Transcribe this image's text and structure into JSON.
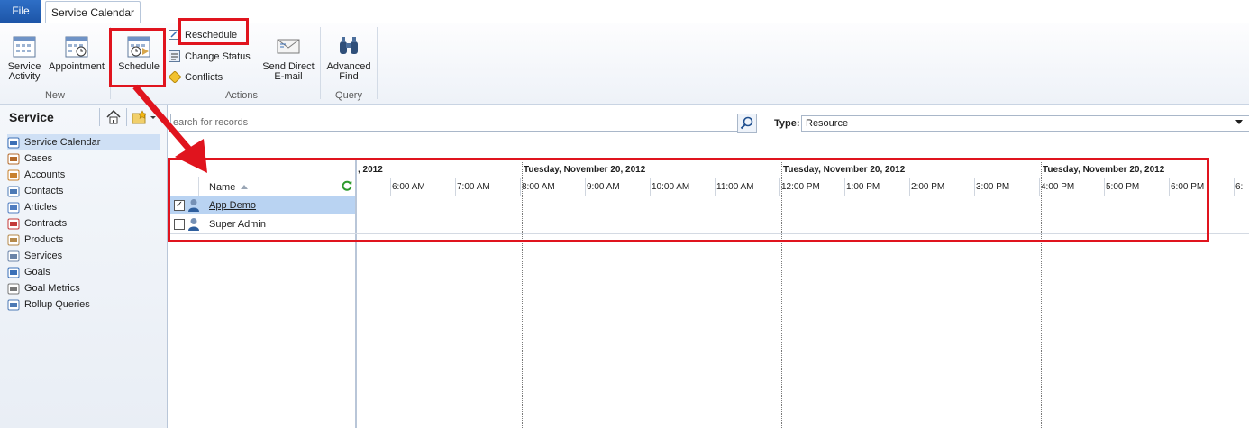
{
  "tabs": {
    "file": "File",
    "active": "Service Calendar"
  },
  "ribbon": {
    "new_group": {
      "label": "New",
      "service_activity": [
        "Service",
        "Activity"
      ],
      "appointment": "Appointment",
      "schedule": "Schedule"
    },
    "actions_group": {
      "label": "Actions",
      "reschedule": "Reschedule",
      "change_status": "Change Status",
      "conflicts": "Conflicts",
      "send_direct_email": [
        "Send Direct",
        "E-mail"
      ]
    },
    "query_group": {
      "label": "Query",
      "advanced_find": [
        "Advanced",
        "Find"
      ]
    }
  },
  "leftnav": {
    "title": "Service",
    "items": [
      {
        "label": "Service Calendar",
        "icon": "calendar-icon",
        "selected": true
      },
      {
        "label": "Cases",
        "icon": "cases-icon"
      },
      {
        "label": "Accounts",
        "icon": "accounts-icon"
      },
      {
        "label": "Contacts",
        "icon": "contacts-icon"
      },
      {
        "label": "Articles",
        "icon": "articles-icon"
      },
      {
        "label": "Contracts",
        "icon": "contracts-icon"
      },
      {
        "label": "Products",
        "icon": "products-icon"
      },
      {
        "label": "Services",
        "icon": "services-icon"
      },
      {
        "label": "Goals",
        "icon": "goals-icon"
      },
      {
        "label": "Goal Metrics",
        "icon": "goal-metrics-icon"
      },
      {
        "label": "Rollup Queries",
        "icon": "rollup-queries-icon"
      }
    ]
  },
  "search": {
    "placeholder": "Search for records",
    "value": "earch for records"
  },
  "type_filter": {
    "label": "Type:",
    "value": "Resource"
  },
  "grid": {
    "name_header": "Name",
    "resources": [
      {
        "name": "App Demo",
        "checked": true
      },
      {
        "name": "Super Admin",
        "checked": false
      }
    ],
    "dates": [
      ", 2012",
      "Tuesday, November 20, 2012",
      "Tuesday, November 20, 2012",
      "Tuesday, November 20, 2012"
    ],
    "times": [
      "6:00 AM",
      "7:00 AM",
      "8:00 AM",
      "9:00 AM",
      "10:00 AM",
      "11:00 AM",
      "12:00 PM",
      "1:00 PM",
      "2:00 PM",
      "3:00 PM",
      "4:00 PM",
      "5:00 PM",
      "6:00 PM",
      "6:"
    ]
  },
  "colors": {
    "annotation": "#e0141e",
    "selected_row": "#b9d3f2",
    "file_tab": "#2563b8"
  }
}
